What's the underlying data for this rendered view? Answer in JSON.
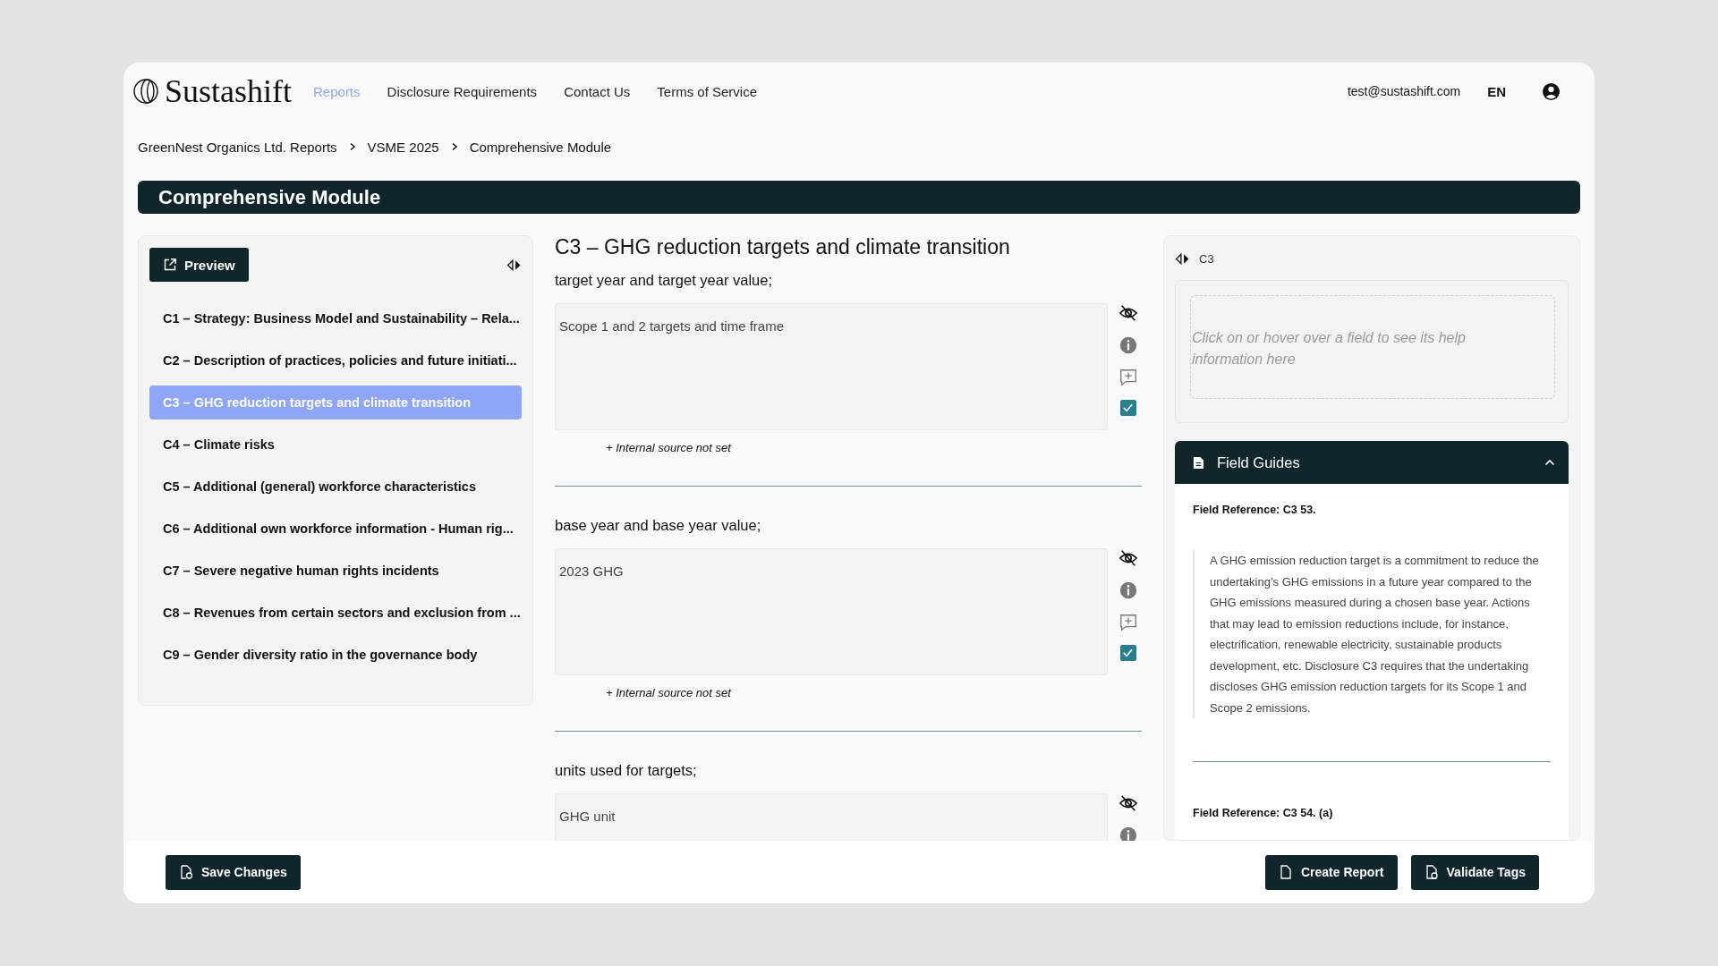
{
  "brand": "Sustashift",
  "nav": [
    {
      "label": "Reports",
      "selected": true
    },
    {
      "label": "Disclosure Requirements",
      "selected": false
    },
    {
      "label": "Contact Us",
      "selected": false
    },
    {
      "label": "Terms of Service",
      "selected": false
    }
  ],
  "user_email": "test@sustashift.com",
  "language": "EN",
  "breadcrumb": [
    "GreenNest Organics Ltd. Reports",
    "VSME 2025",
    "Comprehensive Module"
  ],
  "page_title": "Comprehensive Module",
  "sidebar": {
    "preview_button": "Preview",
    "items": [
      {
        "label": "C1 – Strategy: Business Model and Sustainability – Rela...",
        "selected": false
      },
      {
        "label": "C2 – Description of practices, policies and future initiati...",
        "selected": false
      },
      {
        "label": "C3 – GHG reduction targets and climate transition",
        "selected": true
      },
      {
        "label": "C4 – Climate risks",
        "selected": false
      },
      {
        "label": "C5 – Additional (general) workforce characteristics",
        "selected": false
      },
      {
        "label": "C6 – Additional own workforce information - Human rig...",
        "selected": false
      },
      {
        "label": "C7 – Severe negative human rights incidents",
        "selected": false
      },
      {
        "label": "C8 – Revenues from certain sectors and exclusion from ...",
        "selected": false
      },
      {
        "label": "C9 – Gender diversity ratio in the governance body",
        "selected": false
      }
    ]
  },
  "section_title": "C3 – GHG reduction targets and climate transition",
  "fields": [
    {
      "label": "target year and target year value;",
      "value": "Scope 1 and 2 targets and time frame",
      "checked": true,
      "source_link": "+ Internal source not set"
    },
    {
      "label": "base year and base year value;",
      "value": "2023 GHG",
      "checked": true,
      "source_link": "+ Internal source not set"
    },
    {
      "label": "units used for targets;",
      "value": "GHG unit"
    }
  ],
  "help_panel": {
    "section": "C3",
    "hint": "Click on or hover over a field to see its help information here"
  },
  "field_guides": {
    "title": "Field Guides",
    "expanded": true,
    "entries": [
      {
        "reference": "Field Reference: C3 53.",
        "text": "A GHG emission reduction target is a commitment to reduce the undertaking’s GHG emissions in a future year compared to the GHG emissions measured during a chosen base year. Actions that may lead to emission reductions include, for instance, electrification, renewable electricity, sustainable products development, etc. Disclosure C3 requires that the undertaking discloses GHG emission reduction targets for its Scope 1 and Scope 2 emissions."
      },
      {
        "reference": "Field Reference: C3 54. (a)"
      }
    ]
  },
  "footer": {
    "left_buttons": [
      "Save Changes"
    ],
    "right_buttons": [
      "Create Report",
      "Validate Tags"
    ]
  }
}
